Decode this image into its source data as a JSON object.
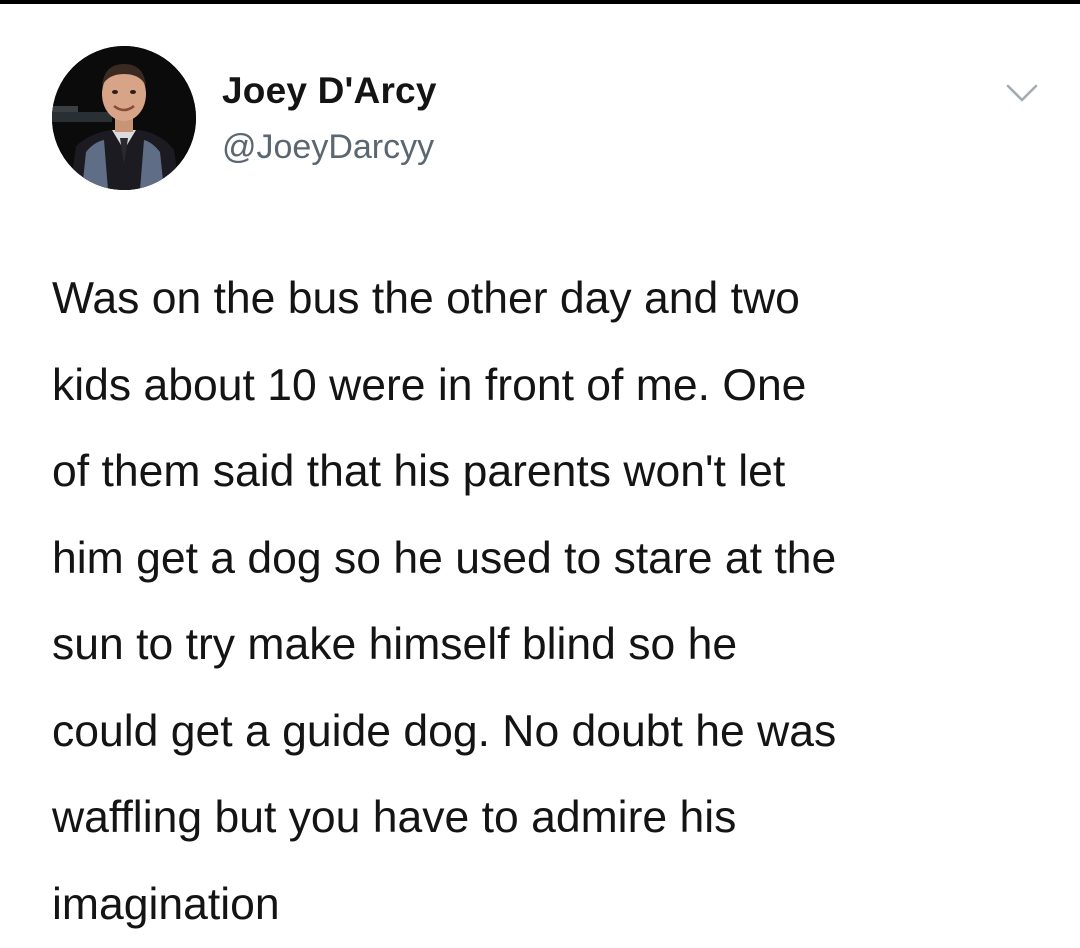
{
  "author": {
    "display_name": "Joey D'Arcy",
    "handle": "@JoeyDarcyy",
    "avatar_icon": "profile-photo"
  },
  "menu": {
    "icon": "chevron-down-icon"
  },
  "tweet": {
    "lines": [
      "Was on the bus the other day and two",
      "kids about 10 were in front of me. One",
      "of them said that his parents won't let",
      "him get a dog so he used to stare at the",
      "sun to try make himself blind so he",
      "could get a guide dog. No doubt he was",
      "waffling but you have to admire his",
      "imagination"
    ]
  }
}
